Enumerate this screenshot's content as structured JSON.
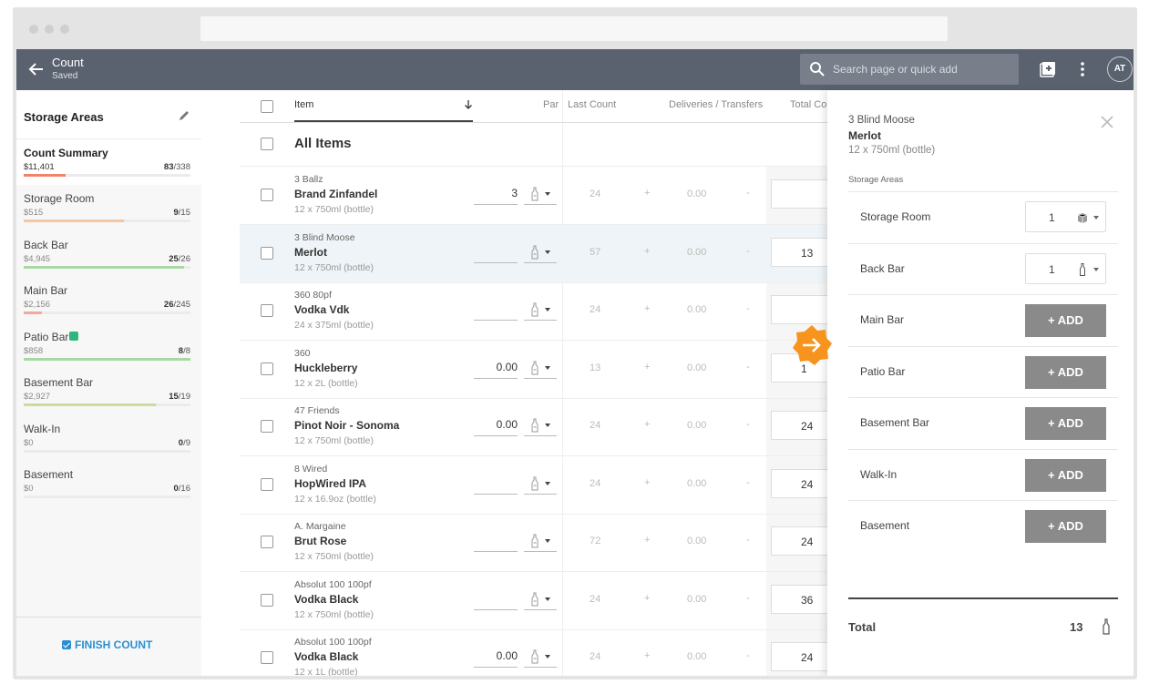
{
  "topbar": {
    "title": "Count",
    "subtitle": "Saved",
    "search_placeholder": "Search page or quick add",
    "avatar": "AT"
  },
  "sidebar": {
    "title": "Storage Areas",
    "summary": {
      "name": "Count Summary",
      "value": "$11,401",
      "counted": "83",
      "total": "/338",
      "progress": 0.25,
      "color": "#f0846a"
    },
    "areas": [
      {
        "name": "Storage Room",
        "value": "$515",
        "counted": "9",
        "total": "/15",
        "progress": 0.6,
        "color": "#f5c6a0"
      },
      {
        "name": "Back Bar",
        "value": "$4,945",
        "counted": "25",
        "total": "/26",
        "progress": 0.96,
        "color": "#a8d8a4"
      },
      {
        "name": "Main Bar",
        "value": "$2,156",
        "counted": "26",
        "total": "/245",
        "progress": 0.11,
        "color": "#f5a99a"
      },
      {
        "name": "Patio Bar",
        "value": "$858",
        "counted": "8",
        "total": "/8",
        "progress": 1.0,
        "color": "#a8d8a4"
      },
      {
        "name": "Basement Bar",
        "value": "$2,927",
        "counted": "15",
        "total": "/19",
        "progress": 0.79,
        "color": "#c9dca0"
      },
      {
        "name": "Walk-In",
        "value": "$0",
        "counted": "0",
        "total": "/9",
        "progress": 0,
        "color": "#ddd"
      },
      {
        "name": "Basement",
        "value": "$0",
        "counted": "0",
        "total": "/16",
        "progress": 0,
        "color": "#ddd"
      }
    ],
    "finish_label": "FINISH COUNT"
  },
  "table": {
    "headers": {
      "item": "Item",
      "par": "Par",
      "last_count": "Last Count",
      "deliveries": "Deliveries / Transfers",
      "total": "Total Co"
    },
    "all_items": "All Items",
    "rows": [
      {
        "brand": "3 Ballz",
        "name": "Brand Zinfandel",
        "size": "12 x 750ml (bottle)",
        "qty": "3",
        "last": "24",
        "plus": "+",
        "del": "0.00",
        "minus": "-",
        "total": ""
      },
      {
        "brand": "3 Blind Moose",
        "name": "Merlot",
        "size": "12 x 750ml (bottle)",
        "qty": "",
        "last": "57",
        "plus": "+",
        "del": "0.00",
        "minus": "-",
        "total": "13"
      },
      {
        "brand": "360 80pf",
        "name": "Vodka Vdk",
        "size": "24 x 375ml (bottle)",
        "qty": "",
        "last": "24",
        "plus": "+",
        "del": "0.00",
        "minus": "-",
        "total": ""
      },
      {
        "brand": "360",
        "name": "Huckleberry",
        "size": "12 x 2L (bottle)",
        "qty": "0.00",
        "last": "13",
        "plus": "+",
        "del": "0.00",
        "minus": "-",
        "total": "1"
      },
      {
        "brand": "47 Friends",
        "name": "Pinot Noir - Sonoma",
        "size": "12 x 750ml (bottle)",
        "qty": "0.00",
        "last": "24",
        "plus": "+",
        "del": "0.00",
        "minus": "-",
        "total": "24"
      },
      {
        "brand": "8 Wired",
        "name": "HopWired IPA",
        "size": "12 x 16.9oz (bottle)",
        "qty": "",
        "last": "24",
        "plus": "+",
        "del": "0.00",
        "minus": "-",
        "total": "24"
      },
      {
        "brand": "A. Margaine",
        "name": "Brut Rose",
        "size": "12 x 750ml (bottle)",
        "qty": "",
        "last": "72",
        "plus": "+",
        "del": "0.00",
        "minus": "-",
        "total": "24"
      },
      {
        "brand": "Absolut 100 100pf",
        "name": "Vodka Black",
        "size": "12 x 750ml (bottle)",
        "qty": "",
        "last": "24",
        "plus": "+",
        "del": "0.00",
        "minus": "-",
        "total": "36"
      },
      {
        "brand": "Absolut 100 100pf",
        "name": "Vodka Black",
        "size": "12 x 1L (bottle)",
        "qty": "0.00",
        "last": "24",
        "plus": "+",
        "del": "0.00",
        "minus": "-",
        "total": "24"
      }
    ]
  },
  "panel": {
    "brand": "3 Blind Moose",
    "name": "Merlot",
    "size": "12 x 750ml (bottle)",
    "section_label": "Storage Areas",
    "areas": [
      {
        "name": "Storage Room",
        "qty": "1",
        "icon": "case-icon"
      },
      {
        "name": "Back Bar",
        "qty": "1",
        "icon": "bottle-icon"
      },
      {
        "name": "Main Bar",
        "add": "+ ADD"
      },
      {
        "name": "Patio Bar",
        "add": "+ ADD"
      },
      {
        "name": "Basement Bar",
        "add": "+ ADD"
      },
      {
        "name": "Walk-In",
        "add": "+ ADD"
      },
      {
        "name": "Basement",
        "add": "+ ADD"
      }
    ],
    "total_label": "Total",
    "total_value": "13"
  },
  "colors": {
    "topbar": "#5a6270",
    "accent": "#2a8fd0",
    "badge": "#f7941d",
    "add_button": "#8a8a8a"
  }
}
